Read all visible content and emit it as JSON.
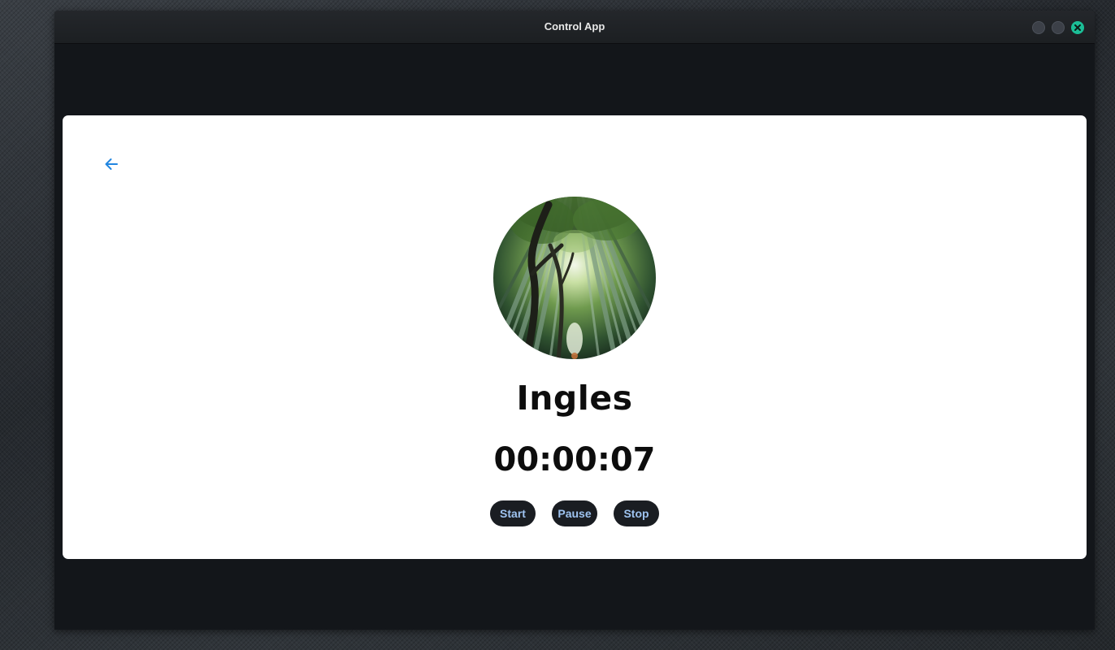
{
  "window": {
    "title": "Control App"
  },
  "icons": {
    "back": "arrow-left-icon",
    "close": "close-icon",
    "avatar_image": "bamboo-forest-photo"
  },
  "task": {
    "name": "Ingles",
    "elapsed": "00:00:07"
  },
  "controls": {
    "start_label": "Start",
    "pause_label": "Pause",
    "stop_label": "Stop"
  },
  "colors": {
    "accent_blue": "#2286e0",
    "button_bg": "#1a1d22",
    "button_text": "#9ec3f0",
    "close_green": "#1bbd96",
    "window_bg": "#13161a"
  }
}
